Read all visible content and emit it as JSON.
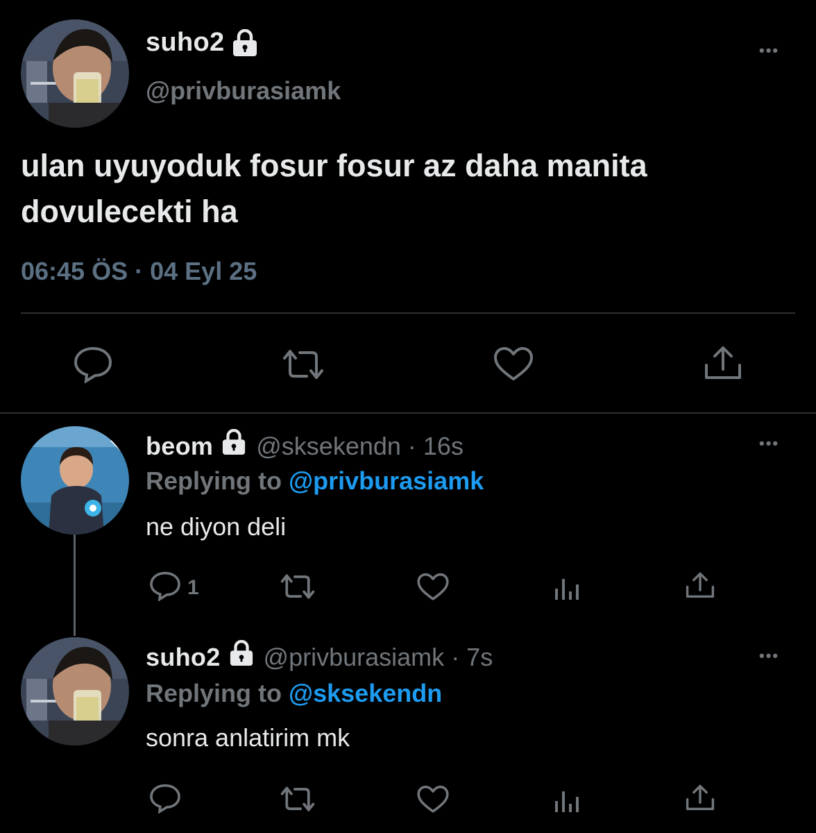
{
  "main_tweet": {
    "display_name": "suho2",
    "handle": "@privburasiamk",
    "text_line1": "ulan uyuyoduk fosur fosur az daha manita",
    "text_line2": "dovulecekti ha",
    "time": "06:45 ÖS",
    "separator": "·",
    "date": "04 Eyl 25",
    "more_label": "•••",
    "actions": [
      "reply-icon",
      "retweet-icon",
      "like-icon",
      "share-icon"
    ]
  },
  "replies": [
    {
      "display_name": "beom",
      "handle": "@sksekendn",
      "time": "· 16s",
      "replying_prefix": "Replying to",
      "replying_to": "@privburasiamk",
      "text": "ne diyon deli",
      "reply_count": "1",
      "more_label": "•••"
    },
    {
      "display_name": "suho2",
      "handle": "@privburasiamk",
      "time": "· 7s",
      "replying_prefix": "Replying to",
      "replying_to": "@sksekendn",
      "text": "sonra anlatirim mk",
      "reply_count": "",
      "more_label": "•••"
    }
  ],
  "colors": {
    "background": "#000000",
    "text": "#e7e9ea",
    "secondary": "#71767b",
    "link": "#1d9bf0",
    "divider": "#2f3336"
  }
}
